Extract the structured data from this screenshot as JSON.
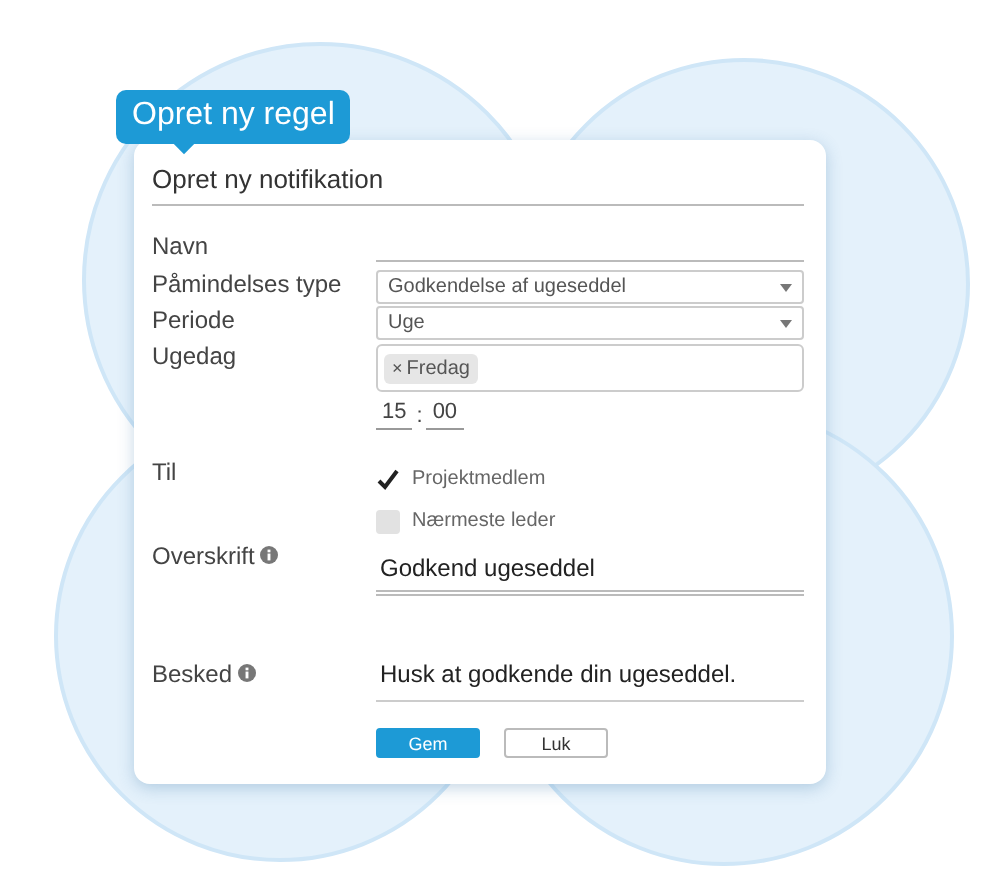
{
  "badge": {
    "label": "Opret ny regel"
  },
  "form": {
    "title": "Opret ny notifikation",
    "fields": [
      {
        "kind": "text",
        "label": "Navn"
      },
      {
        "kind": "select",
        "label": "Påmindelses type",
        "value": "Godkendelse af ugeseddel"
      },
      {
        "kind": "select",
        "label": "Periode",
        "value": "Uge"
      },
      {
        "kind": "tags",
        "label": "Ugedag",
        "tags": [
          {
            "remove": "×",
            "text": "Fredag"
          }
        ]
      },
      {
        "kind": "time",
        "hours": "15",
        "separator": ":",
        "minutes": "00"
      },
      {
        "kind": "checks",
        "label": "Til",
        "options": [
          {
            "label": "Projektmedlem",
            "checked": true
          },
          {
            "label": "Nærmeste leder",
            "checked": false
          }
        ]
      },
      {
        "kind": "input",
        "label": "Overskrift",
        "info": true,
        "value": "Godkend ugeseddel"
      },
      {
        "kind": "textarea",
        "label": "Besked",
        "info": true,
        "value": "Husk at godkende din ugeseddel."
      }
    ],
    "buttons": [
      {
        "label": "Gem",
        "primary": true
      },
      {
        "label": "Luk",
        "primary": false
      }
    ]
  }
}
